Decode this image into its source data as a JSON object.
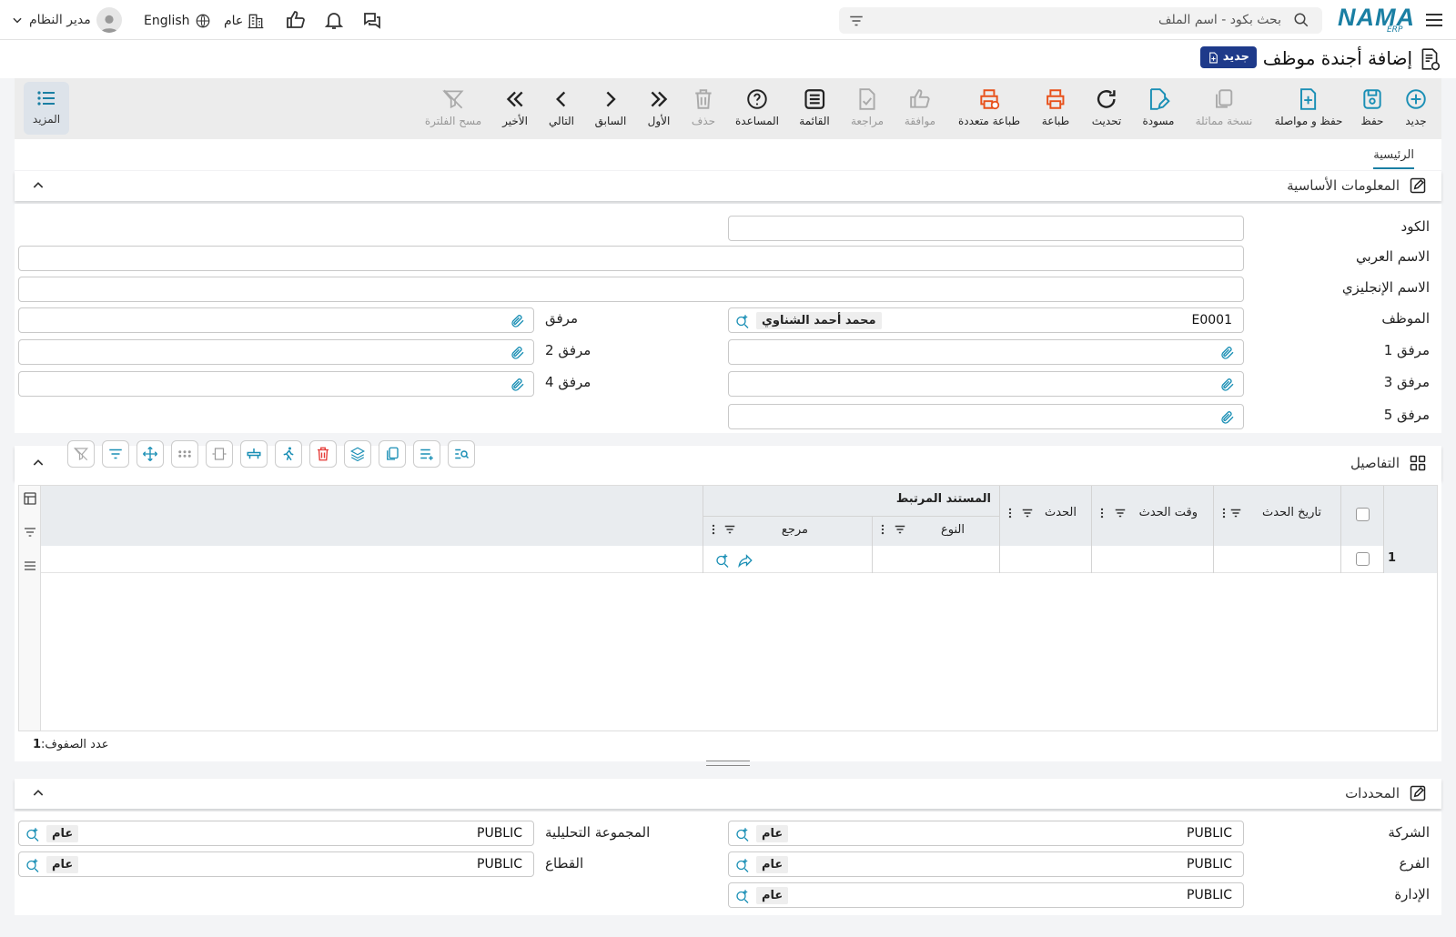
{
  "topbar": {
    "brand": "NAMA",
    "brand_sub": "ERP",
    "search_placeholder": "بحث بكود - اسم الملف",
    "user_name": "مدير النظام",
    "language": "English",
    "scope": "عام"
  },
  "title": {
    "page_title": "إضافة أجندة موظف",
    "new_badge": "جديد"
  },
  "toolbar": {
    "buttons": [
      {
        "label": "جديد",
        "icon": "plus-circle-icon"
      },
      {
        "label": "حفظ",
        "icon": "save-icon"
      },
      {
        "label": "حفظ و مواصلة",
        "icon": "save-continue-icon"
      },
      {
        "label": "نسخة مماثلة",
        "icon": "copy-icon"
      },
      {
        "label": "مسودة",
        "icon": "draft-icon"
      },
      {
        "label": "تحديث",
        "icon": "refresh-icon"
      },
      {
        "label": "طباعة",
        "icon": "print-icon"
      },
      {
        "label": "طباعة متعددة",
        "icon": "multi-print-icon"
      },
      {
        "label": "موافقة",
        "icon": "thumbs-up-icon"
      },
      {
        "label": "مراجعة",
        "icon": "review-icon"
      },
      {
        "label": "القائمة",
        "icon": "list-icon"
      },
      {
        "label": "المساعدة",
        "icon": "help-icon"
      },
      {
        "label": "حذف",
        "icon": "trash-icon"
      },
      {
        "label": "الأول",
        "icon": "first-icon"
      },
      {
        "label": "السابق",
        "icon": "prev-icon"
      },
      {
        "label": "التالي",
        "icon": "next-icon"
      },
      {
        "label": "الأخير",
        "icon": "last-icon"
      },
      {
        "label": "مسح الفلترة",
        "icon": "clear-filter-icon"
      }
    ],
    "more_label": "المزيد"
  },
  "tabs": {
    "main": "الرئيسية"
  },
  "basic_info": {
    "section_title": "المعلومات الأساسية",
    "code_label": "الكود",
    "code_value": "",
    "arabic_name_label": "الاسم العربي",
    "arabic_name_value": "",
    "english_name_label": "الاسم الإنجليزي",
    "english_name_value": "",
    "employee_label": "الموظف",
    "employee_code": "E0001",
    "employee_name": "محمد أحمد الشناوي",
    "attachment_label": "مرفق",
    "attachment1_label": "مرفق 1",
    "attachment2_label": "مرفق 2",
    "attachment3_label": "مرفق 3",
    "attachment4_label": "مرفق 4",
    "attachment5_label": "مرفق 5"
  },
  "details": {
    "section_title": "التفاصيل",
    "columns": {
      "event_date": "تاريخ الحدث",
      "event_time": "وقت الحدث",
      "event": "الحدث",
      "related_document": "المستند المرتبط",
      "type": "النوع",
      "reference": "مرجع"
    },
    "rows": [
      {
        "index": "1"
      }
    ],
    "row_count_label": "عدد الصفوف:",
    "row_count": "1"
  },
  "dimensions": {
    "section_title": "المحددات",
    "company_label": "الشركة",
    "company_code": "PUBLIC",
    "company_name": "عام",
    "branch_label": "الفرع",
    "branch_code": "PUBLIC",
    "branch_name": "عام",
    "department_label": "الإدارة",
    "department_code": "PUBLIC",
    "department_name": "عام",
    "analytic_group_label": "المجموعة التحليلية",
    "analytic_group_code": "PUBLIC",
    "analytic_group_name": "عام",
    "sector_label": "القطاع",
    "sector_code": "PUBLIC",
    "sector_name": "عام"
  },
  "colors": {
    "accent": "#1a8fb5",
    "brand": "#1a7fa3",
    "badge": "#1e3a8a",
    "print": "#e8501a"
  }
}
